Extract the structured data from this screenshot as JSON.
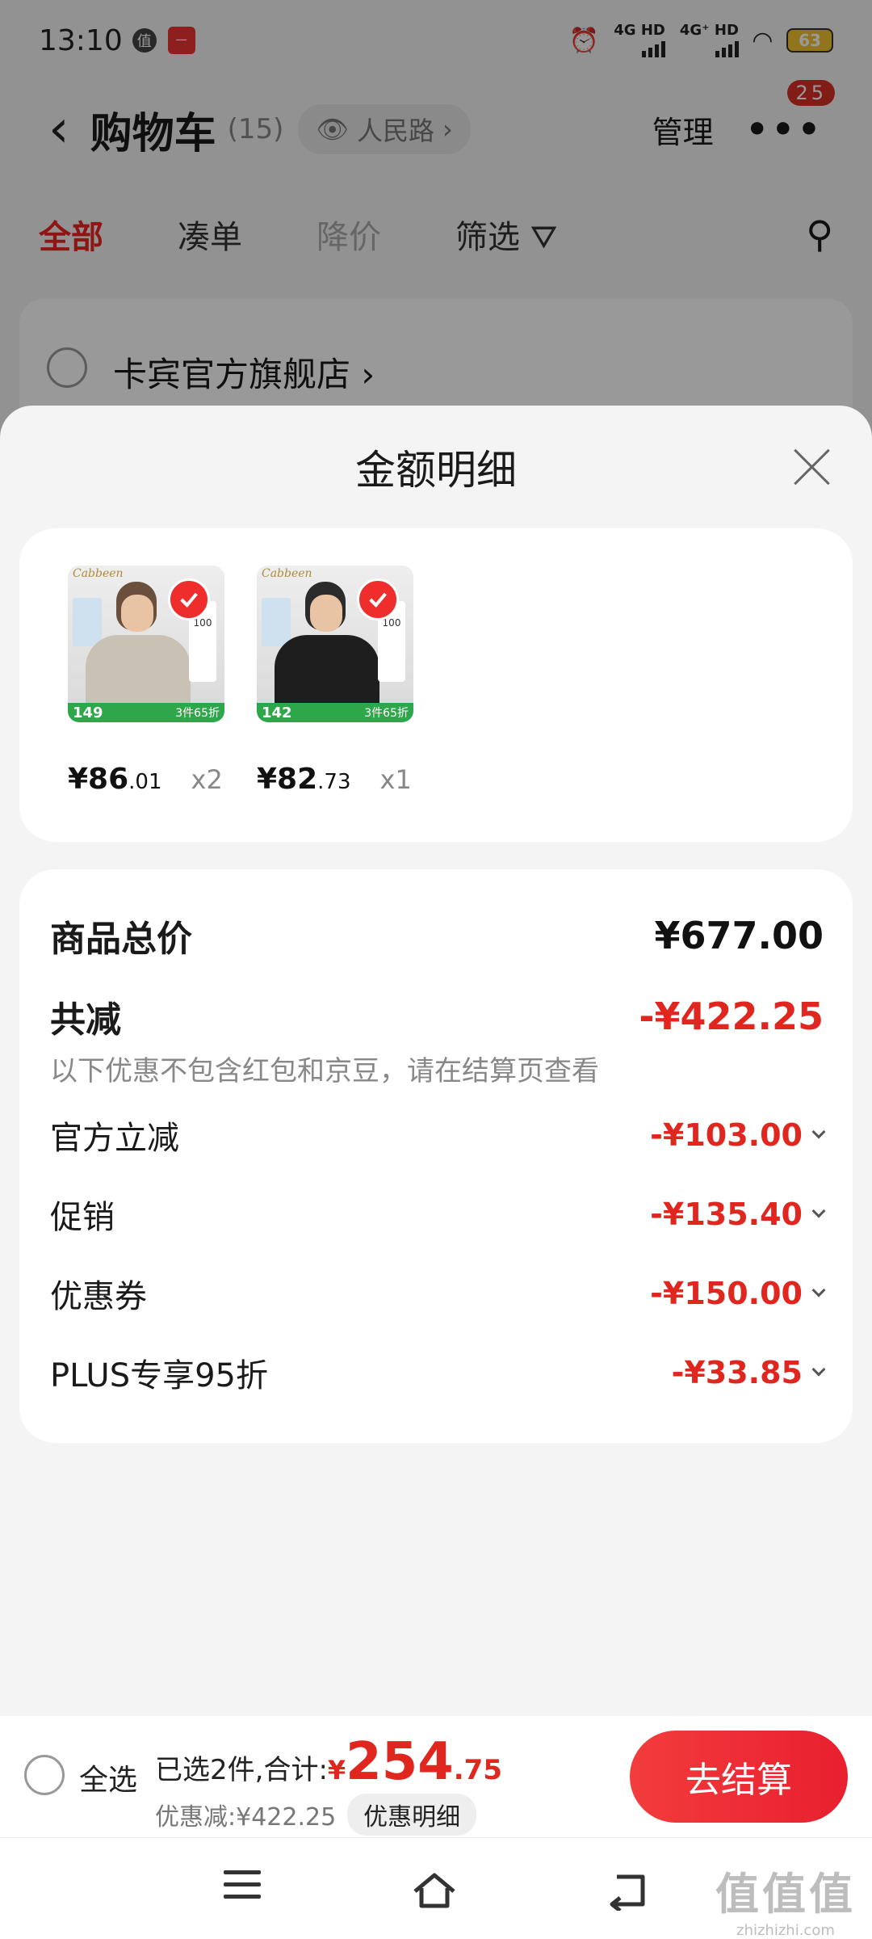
{
  "status_bar": {
    "time": "13:10",
    "badge_a": "值",
    "badge_b": "一",
    "signal1": "4G HD",
    "signal2": "4G⁺ HD",
    "battery": "63"
  },
  "header": {
    "title": "购物车",
    "count": "(15)",
    "location": "人民路",
    "manage": "管理",
    "more_badge": "25"
  },
  "tabs": [
    "全部",
    "凑单",
    "降价",
    "筛选"
  ],
  "store": {
    "name": "卡宾官方旗舰店"
  },
  "sheet": {
    "title": "金额明细",
    "products": [
      {
        "price_int": "¥86",
        "price_dec": ".01",
        "qty": "x2",
        "thumb_price": "149",
        "thumb_promo": "3件65折",
        "box": "100",
        "brand": "Cabbeen"
      },
      {
        "price_int": "¥82",
        "price_dec": ".73",
        "qty": "x1",
        "thumb_price": "142",
        "thumb_promo": "3件65折",
        "box": "100",
        "brand": "Cabbeen"
      }
    ],
    "total_label": "商品总价",
    "total_value": "¥677.00",
    "reduce_label": "共减",
    "reduce_value": "-¥422.25",
    "reduce_note": "以下优惠不包含红包和京豆，请在结算页查看",
    "items": [
      {
        "label": "官方立减",
        "value": "-¥103.00"
      },
      {
        "label": "促销",
        "value": "-¥135.40"
      },
      {
        "label": "优惠券",
        "value": "-¥150.00"
      },
      {
        "label": "PLUS专享95折",
        "value": "-¥33.85"
      }
    ]
  },
  "bottom_bar": {
    "select_all": "全选",
    "selected_prefix": "已选2件,合计:",
    "total_yen": "¥",
    "total_int": "254",
    "total_dec": ".75",
    "discount_text": "优惠减:¥422.25",
    "detail_button": "优惠明细",
    "checkout": "去结算"
  },
  "watermark": {
    "big": "值值值",
    "small": "zhizhizhi.com"
  },
  "colors": {
    "accent_red": "#e0271f",
    "checkout_gradient": [
      "#f33c3c",
      "#e81f2f"
    ],
    "promo_green": "#2ea64a"
  }
}
